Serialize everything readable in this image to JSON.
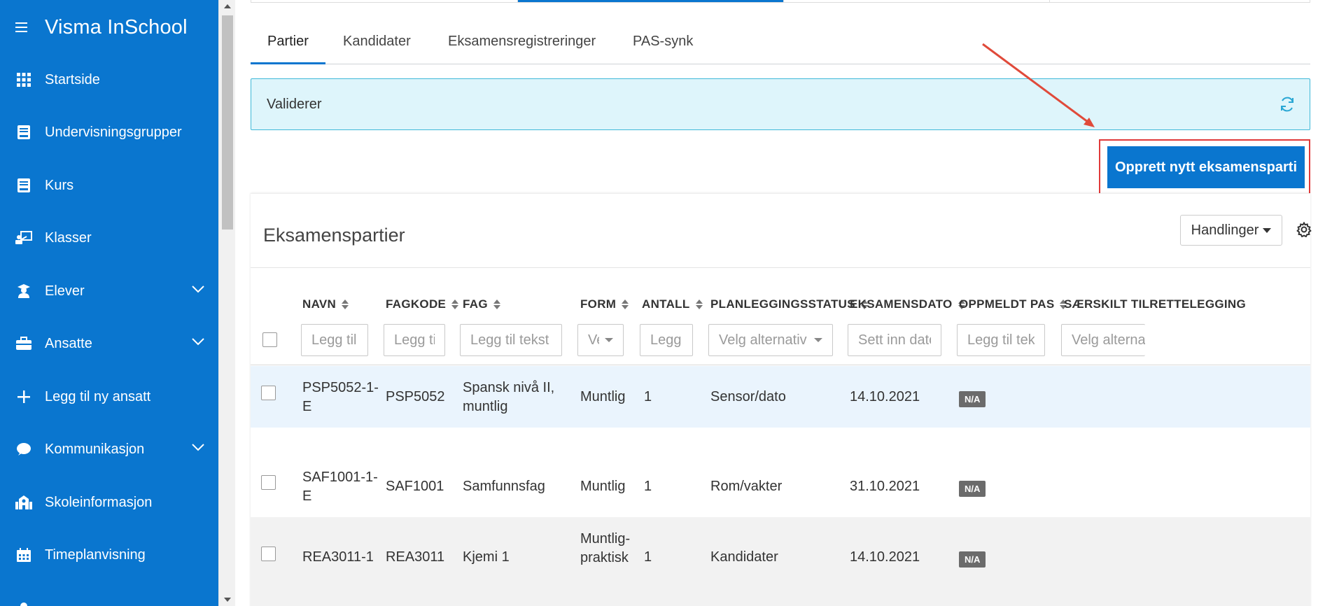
{
  "sidebar": {
    "app_title": "Visma InSchool",
    "items": [
      {
        "label": "Startside",
        "icon": "grid-icon",
        "chevron": false
      },
      {
        "label": "Undervisningsgrupper",
        "icon": "book-icon",
        "chevron": false
      },
      {
        "label": "Kurs",
        "icon": "book-icon",
        "chevron": false
      },
      {
        "label": "Klasser",
        "icon": "classroom-icon",
        "chevron": false
      },
      {
        "label": "Elever",
        "icon": "student-icon",
        "chevron": true
      },
      {
        "label": "Ansatte",
        "icon": "briefcase-icon",
        "chevron": true
      },
      {
        "label": "Legg til ny ansatt",
        "icon": "plus-icon",
        "chevron": false
      },
      {
        "label": "Kommunikasjon",
        "icon": "chat-icon",
        "chevron": true
      },
      {
        "label": "Skoleinformasjon",
        "icon": "school-icon",
        "chevron": false
      },
      {
        "label": "Timeplanvisning",
        "icon": "calendar-icon",
        "chevron": false
      }
    ]
  },
  "tabs": [
    {
      "label": "Partier",
      "active": true
    },
    {
      "label": "Kandidater",
      "active": false
    },
    {
      "label": "Eksamensregistreringer",
      "active": false
    },
    {
      "label": "PAS-synk",
      "active": false
    }
  ],
  "info_bar": {
    "text": "Validerer"
  },
  "primary_action": {
    "label": "Opprett nytt eksamensparti"
  },
  "panel": {
    "title": "Eksamenspartier",
    "actions_label": "Handlinger"
  },
  "table": {
    "columns": [
      {
        "label": "NAVN",
        "filter": "Legg til tekst",
        "filter_type": "text"
      },
      {
        "label": "FAGKODE",
        "filter": "Legg til tekst",
        "filter_type": "text"
      },
      {
        "label": "FAG",
        "filter": "Legg til tekst",
        "filter_type": "text"
      },
      {
        "label": "FORM",
        "filter": "Velg alternativ",
        "filter_type": "select"
      },
      {
        "label": "ANTALL",
        "filter": "Legg til tekst",
        "filter_type": "text"
      },
      {
        "label": "PLANLEGGINGSSTATUS",
        "filter": "Velg alternativ",
        "filter_type": "select"
      },
      {
        "label": "EKSAMENSDATO",
        "filter": "Sett inn dato",
        "filter_type": "date"
      },
      {
        "label": "OPPMELDT PAS",
        "filter": "Legg til tekst",
        "filter_type": "text"
      },
      {
        "label": "SÆRSKILT TILRETTELEGGING",
        "filter": "Velg alternativ",
        "filter_type": "select"
      }
    ],
    "rows": [
      {
        "navn": "PSP5052-1-E",
        "fagkode": "PSP5052",
        "fag": "Spansk nivå II, muntlig",
        "form": "Muntlig",
        "antall": "1",
        "status": "Sensor/dato",
        "dato": "14.10.2021",
        "pas": "N/A"
      },
      {
        "navn": "SAF1001-1-E",
        "fagkode": "SAF1001",
        "fag": "Samfunnsfag",
        "form": "Muntlig",
        "antall": "1",
        "status": "Rom/vakter",
        "dato": "31.10.2021",
        "pas": "N/A"
      },
      {
        "navn": "REA3011-1",
        "fagkode": "REA3011",
        "fag": "Kjemi 1",
        "form": "Muntlig-praktisk",
        "antall": "1",
        "status": "Kandidater",
        "dato": "14.10.2021",
        "pas": "N/A"
      }
    ]
  },
  "colors": {
    "brand": "#0a76cf",
    "info_bg": "#def5fb",
    "highlight": "#e03a3a",
    "row_selected": "#eaf4fd",
    "row_alt": "#f2f2f2"
  }
}
